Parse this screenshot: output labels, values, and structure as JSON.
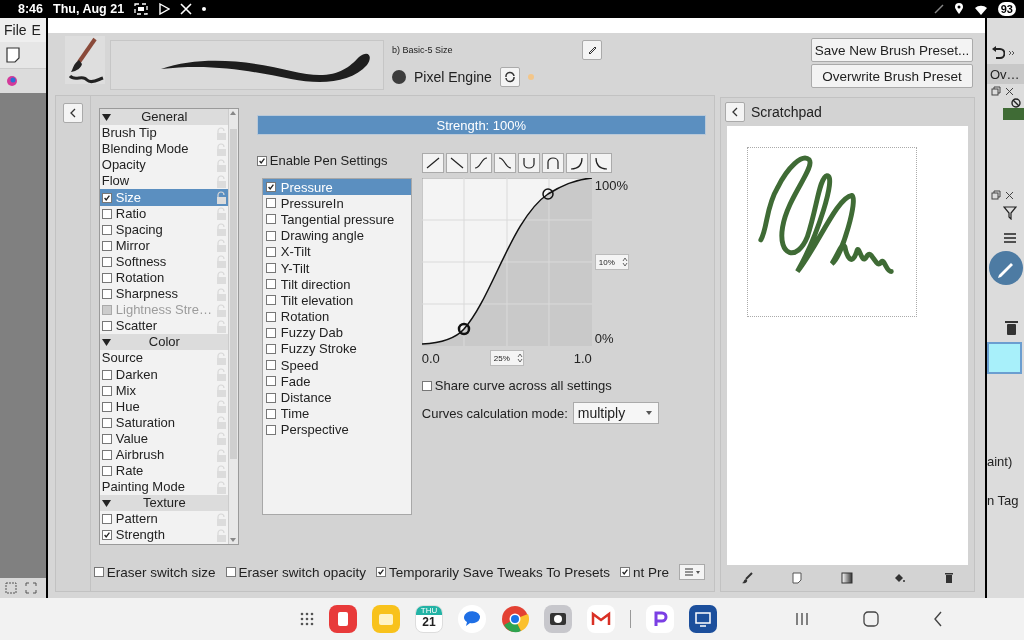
{
  "status_bar": {
    "time": "8:46",
    "date": "Thu, Aug 21",
    "battery": "93"
  },
  "background_app": {
    "menu": [
      "File",
      "E"
    ],
    "right_tab": "Ov…",
    "right_texts": [
      "aint)",
      "n Tag"
    ]
  },
  "brush": {
    "preset_name": "b) Basic-5 Size",
    "engine": "Pixel Engine"
  },
  "preset_buttons": [
    "Save New Brush Preset...",
    "Overwrite Brush Preset"
  ],
  "options": [
    {
      "kind": "header",
      "label": "General",
      "expanded": true,
      "selected": false,
      "disabled": false
    },
    {
      "kind": "item",
      "label": "Brush Tip",
      "selected": false,
      "disabled": false
    },
    {
      "kind": "item",
      "label": "Blending Mode",
      "selected": false,
      "disabled": false
    },
    {
      "kind": "item",
      "label": "Opacity",
      "selected": false,
      "disabled": false
    },
    {
      "kind": "item",
      "label": "Flow",
      "selected": false,
      "disabled": false
    },
    {
      "kind": "check",
      "label": "Size",
      "checked": true,
      "selected": true,
      "disabled": false
    },
    {
      "kind": "check",
      "label": "Ratio",
      "checked": false,
      "selected": false,
      "disabled": false
    },
    {
      "kind": "check",
      "label": "Spacing",
      "checked": false,
      "selected": false,
      "disabled": false
    },
    {
      "kind": "check",
      "label": "Mirror",
      "checked": false,
      "selected": false,
      "disabled": false
    },
    {
      "kind": "check",
      "label": "Softness",
      "checked": false,
      "selected": false,
      "disabled": false
    },
    {
      "kind": "check",
      "label": "Rotation",
      "checked": false,
      "selected": false,
      "disabled": false
    },
    {
      "kind": "check",
      "label": "Sharpness",
      "checked": false,
      "selected": false,
      "disabled": false
    },
    {
      "kind": "check",
      "label": "Lightness Stre…",
      "checked": false,
      "selected": false,
      "disabled": true
    },
    {
      "kind": "check",
      "label": "Scatter",
      "checked": false,
      "selected": false,
      "disabled": false
    },
    {
      "kind": "header",
      "label": "Color",
      "expanded": true,
      "selected": false,
      "disabled": false
    },
    {
      "kind": "item",
      "label": "Source",
      "selected": false,
      "disabled": false
    },
    {
      "kind": "check",
      "label": "Darken",
      "checked": false,
      "selected": false,
      "disabled": false
    },
    {
      "kind": "check",
      "label": "Mix",
      "checked": false,
      "selected": false,
      "disabled": false
    },
    {
      "kind": "check",
      "label": "Hue",
      "checked": false,
      "selected": false,
      "disabled": false
    },
    {
      "kind": "check",
      "label": "Saturation",
      "checked": false,
      "selected": false,
      "disabled": false
    },
    {
      "kind": "check",
      "label": "Value",
      "checked": false,
      "selected": false,
      "disabled": false
    },
    {
      "kind": "check",
      "label": "Airbrush",
      "checked": false,
      "selected": false,
      "disabled": false
    },
    {
      "kind": "check",
      "label": "Rate",
      "checked": false,
      "selected": false,
      "disabled": false
    },
    {
      "kind": "item",
      "label": "Painting Mode",
      "selected": false,
      "disabled": false
    },
    {
      "kind": "header",
      "label": "Texture",
      "expanded": true,
      "selected": false,
      "disabled": false
    },
    {
      "kind": "check",
      "label": "Pattern",
      "checked": false,
      "selected": false,
      "disabled": false
    },
    {
      "kind": "check",
      "label": "Strength",
      "checked": true,
      "selected": false,
      "disabled": false
    }
  ],
  "strength": {
    "label": "Strength: 100%",
    "level": 1
  },
  "enable_pen_settings": {
    "label": "Enable Pen Settings",
    "checked": true
  },
  "sensors": [
    {
      "label": "Pressure",
      "checked": true,
      "selected": true
    },
    {
      "label": "PressureIn",
      "checked": false,
      "selected": false
    },
    {
      "label": "Tangential pressure",
      "checked": false,
      "selected": false
    },
    {
      "label": "Drawing angle",
      "checked": false,
      "selected": false
    },
    {
      "label": "X-Tilt",
      "checked": false,
      "selected": false
    },
    {
      "label": "Y-Tilt",
      "checked": false,
      "selected": false
    },
    {
      "label": "Tilt direction",
      "checked": false,
      "selected": false
    },
    {
      "label": "Tilt elevation",
      "checked": false,
      "selected": false
    },
    {
      "label": "Rotation",
      "checked": false,
      "selected": false
    },
    {
      "label": "Fuzzy Dab",
      "checked": false,
      "selected": false
    },
    {
      "label": "Fuzzy Stroke",
      "checked": false,
      "selected": false
    },
    {
      "label": "Speed",
      "checked": false,
      "selected": false
    },
    {
      "label": "Fade",
      "checked": false,
      "selected": false
    },
    {
      "label": "Distance",
      "checked": false,
      "selected": false
    },
    {
      "label": "Time",
      "checked": false,
      "selected": false
    },
    {
      "label": "Perspective",
      "checked": false,
      "selected": false
    }
  ],
  "curve": {
    "top_label": "100%",
    "bottom_label": "0%",
    "y_spin": "10%",
    "x_start": "0.0",
    "x_spin": "25%",
    "x_end": "1.0"
  },
  "share_curve": {
    "label": "Share curve across all settings",
    "checked": false
  },
  "calc_mode": {
    "label": "Curves calculation mode:",
    "value": "multiply"
  },
  "bottom_options": [
    {
      "label": "Eraser switch size",
      "checked": false
    },
    {
      "label": "Eraser switch opacity",
      "checked": false
    },
    {
      "label": "Temporarily Save Tweaks To Presets",
      "checked": true
    },
    {
      "label": "nt Pre",
      "checked": true
    }
  ],
  "scratchpad": {
    "title": "Scratchpad"
  },
  "nav_bar": {
    "calendar_day": "THU",
    "calendar_date": "21"
  }
}
